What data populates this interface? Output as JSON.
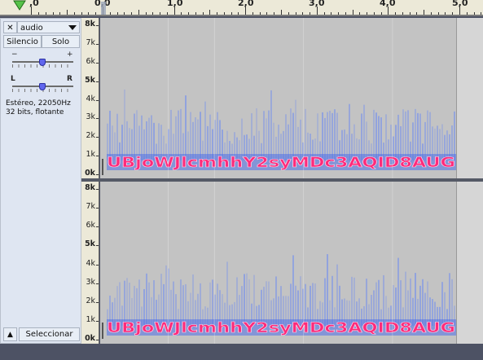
{
  "ruler": {
    "labels": [
      ",0",
      "0,0",
      "1,0",
      "2,0",
      "3,0",
      "4,0",
      "5,0"
    ]
  },
  "track": {
    "close_label": "✕",
    "name": "audio",
    "mute_label": "Silencio",
    "solo_label": "Solo",
    "gain_min": "−",
    "gain_max": "+",
    "pan_left": "L",
    "pan_right": "R",
    "info_line1": "Estéreo, 22050Hz",
    "info_line2": "32 bits, flotante",
    "collapse_label": "▲",
    "select_label": "Seleccionar"
  },
  "axis": {
    "labels": [
      "8k",
      "7k-",
      "6k-",
      "5k-",
      "4k-",
      "3k-",
      "2k-",
      "1k-",
      "0k"
    ]
  },
  "spectrogram": {
    "overlay_text": "UBjoWJlcmhhY2syMDc3AQID8AUG"
  },
  "colors": {
    "ruler_bg": "#ece9d8",
    "panel_bg": "#dfe6f2",
    "spec_bg": "#c3c3c3",
    "text_glow": "#ff2a7a",
    "noise": "#6f8cf0"
  }
}
